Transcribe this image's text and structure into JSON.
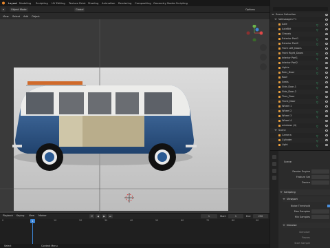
{
  "workspace_tabs": [
    "Layout",
    "Modeling",
    "Sculpting",
    "UV Editing",
    "Texture Paint",
    "Shading",
    "Animation",
    "Rendering",
    "Compositing",
    "Geometry Nodes",
    "Scripting"
  ],
  "scene_name": "Scene",
  "header": {
    "mode": "Object Mode",
    "view": "View",
    "select": "Select",
    "add": "Add",
    "object": "Object",
    "orientation": "Global",
    "options": "Options"
  },
  "viewport": {
    "camera_label": "ObjectMode",
    "accent": "#3d86d8"
  },
  "outliner": {
    "title": "Scene Collection",
    "collection": "Volkswagen T1",
    "items": [
      "Axle",
      "AxleBkt",
      "Chassis",
      "Exterior Part1",
      "Exterior Part2",
      "Front Left_Doors",
      "Front Right_Doors",
      "Interior Part1",
      "Interior Part2",
      "Lights",
      "Rear_Door",
      "Roof",
      "Seats",
      "Side_Door-1",
      "Side_Door-2",
      "Tires_Door",
      "Trunk_Door",
      "Wheel 1",
      "Wheel 2",
      "Wheel 3",
      "Wheel 4",
      "windows (4)"
    ],
    "scene_items": [
      "Scene",
      "Camera",
      "Cylinder",
      "Light"
    ]
  },
  "properties": {
    "title": "Scene",
    "render_engine_label": "Render Engine",
    "feature_set_label": "Feature Set",
    "device_label": "Device",
    "sampling": "Sampling",
    "viewport": "Viewport",
    "noise_threshold": "Noise Threshold",
    "max_samples": "Max Samples",
    "min_samples": "Min Samples",
    "denoise": "Denoise",
    "denoiser": "Denoiser",
    "passes": "Passes",
    "start_sample": "Start Sample"
  },
  "timeline": {
    "playback": "Playback",
    "keying": "Keying",
    "view": "View",
    "marker": "Marker",
    "current_frame": "1",
    "start_label": "Start",
    "start": "1",
    "end_label": "End",
    "end": "250",
    "ticks": [
      "0",
      "10",
      "20",
      "30",
      "40",
      "50",
      "60",
      "70",
      "80",
      "90"
    ],
    "current_tick": "1"
  },
  "status": {
    "left": "Select",
    "middle": "Context Menu"
  }
}
